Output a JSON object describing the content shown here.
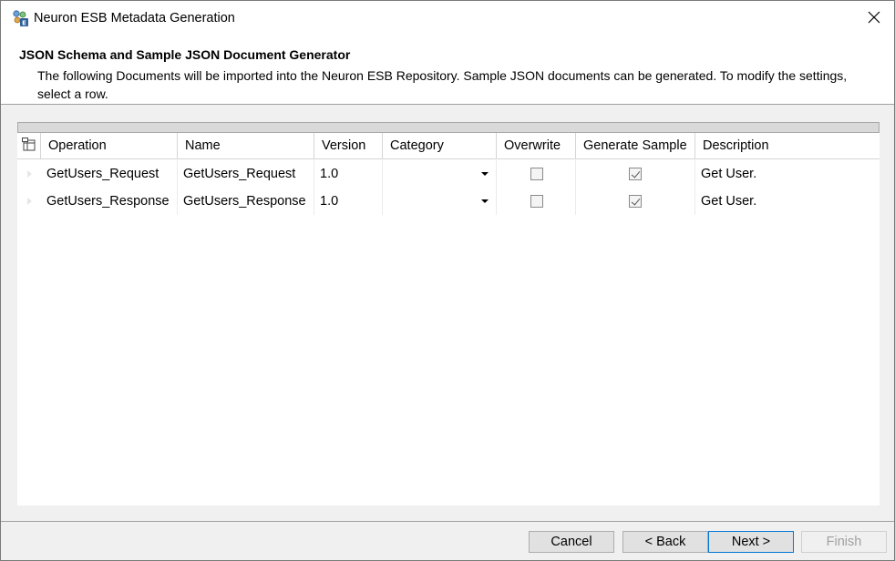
{
  "window": {
    "title": "Neuron ESB Metadata Generation",
    "app_icon": "neuron-esb-app-icon",
    "close_icon": "close-icon"
  },
  "header": {
    "title": "JSON Schema and Sample JSON Document Generator",
    "description": "The following Documents will be imported into the Neuron ESB Repository. Sample JSON documents can be generated. To modify the settings, select a row."
  },
  "grid": {
    "corner_icon": "column-chooser-icon",
    "columns": [
      "Operation",
      "Name",
      "Version",
      "Category",
      "Overwrite",
      "Generate Sample",
      "Description"
    ],
    "rows": [
      {
        "operation": "GetUsers_Request",
        "name": "GetUsers_Request",
        "version": "1.0",
        "category": "",
        "overwrite": false,
        "generate_sample": true,
        "description": "Get User."
      },
      {
        "operation": "GetUsers_Response",
        "name": "GetUsers_Response",
        "version": "1.0",
        "category": "",
        "overwrite": false,
        "generate_sample": true,
        "description": "Get User."
      }
    ]
  },
  "footer": {
    "cancel_label": "Cancel",
    "back_label": "< Back",
    "next_label": "Next >",
    "finish_label": "Finish"
  },
  "colors": {
    "accent": "#0078d7",
    "window_bg": "#f0f0f0",
    "header_bg": "#ffffff"
  }
}
